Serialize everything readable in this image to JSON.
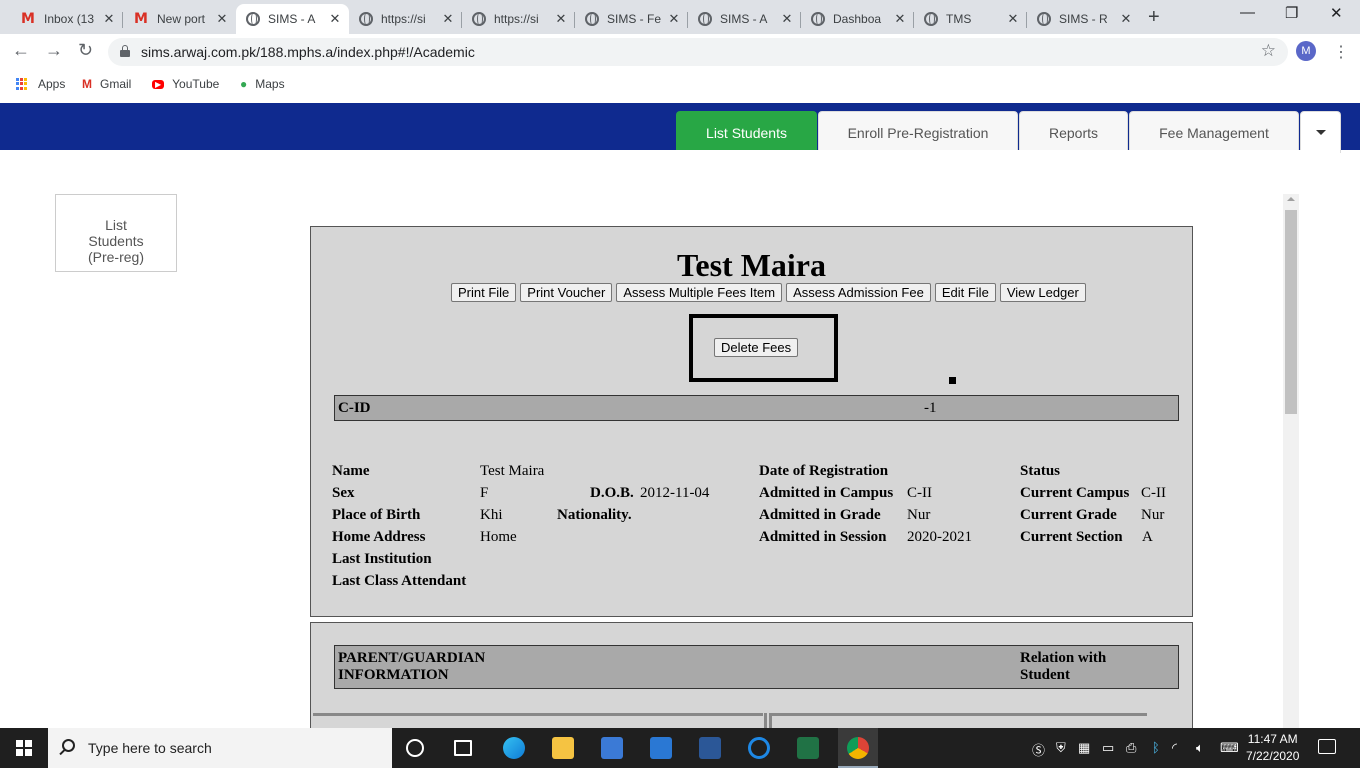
{
  "browser": {
    "tabs": [
      {
        "title": "Inbox (13",
        "icon": "gmail-icon",
        "active": false
      },
      {
        "title": "New port",
        "icon": "gmail-icon",
        "active": false
      },
      {
        "title": "SIMS - A",
        "icon": "globe-icon",
        "active": true
      },
      {
        "title": "https://si",
        "icon": "globe-icon",
        "active": false
      },
      {
        "title": "https://si",
        "icon": "globe-icon",
        "active": false
      },
      {
        "title": "SIMS - Fe",
        "icon": "globe-icon",
        "active": false
      },
      {
        "title": "SIMS - A",
        "icon": "globe-icon",
        "active": false
      },
      {
        "title": "Dashboa",
        "icon": "globe-icon",
        "active": false
      },
      {
        "title": "TMS",
        "icon": "globe-icon",
        "active": false
      },
      {
        "title": "SIMS - R",
        "icon": "globe-icon",
        "active": false
      }
    ],
    "url": "sims.arwaj.com.pk/188.mphs.a/index.php#!/Academic",
    "profile_initial": "M",
    "bookmarks": [
      "Apps",
      "Gmail",
      "YouTube",
      "Maps"
    ]
  },
  "nav": {
    "tabs": [
      "List Students",
      "Enroll Pre-Registration",
      "Reports",
      "Fee Management"
    ],
    "active_color": "#28a745",
    "bar_color": "#0f2a8f"
  },
  "sidebar": {
    "button_lines": [
      "List",
      "Students",
      "(Pre-reg)"
    ]
  },
  "student": {
    "name": "Test Maira",
    "actions": [
      "Print File",
      "Print Voucher",
      "Assess Multiple Fees Item",
      "Assess Admission Fee",
      "Edit File",
      "View Ledger"
    ],
    "delete_label": "Delete Fees",
    "cid_label": "C-ID",
    "cid_value": "-1",
    "labels": {
      "name": "Name",
      "sex": "Sex",
      "dob": "D.O.B.",
      "place_of_birth": "Place of Birth",
      "nationality": "Nationality.",
      "home_address": "Home Address",
      "last_institution": "Last Institution",
      "last_class": "Last Class Attendant",
      "date_of_registration": "Date of Registration",
      "admitted_campus": "Admitted in Campus",
      "admitted_grade": "Admitted in Grade",
      "admitted_session": "Admitted in Session",
      "status": "Status",
      "current_campus": "Current Campus",
      "current_grade": "Current Grade",
      "current_section": "Current Section"
    },
    "values": {
      "name": "Test Maira",
      "sex": "F",
      "dob": "2012-11-04",
      "place_of_birth": "Khi",
      "home_address": "Home",
      "admitted_campus": "C-II",
      "admitted_grade": "Nur",
      "admitted_session": "2020-2021",
      "current_campus": "C-II",
      "current_grade": "Nur",
      "current_section": "A"
    }
  },
  "parent": {
    "header_left_1": "PARENT/GUARDIAN",
    "header_left_2": "INFORMATION",
    "header_right_1": "Relation with",
    "header_right_2": "Student"
  },
  "taskbar": {
    "search_placeholder": "Type here to search",
    "time": "11:47 AM",
    "date": "7/22/2020"
  }
}
